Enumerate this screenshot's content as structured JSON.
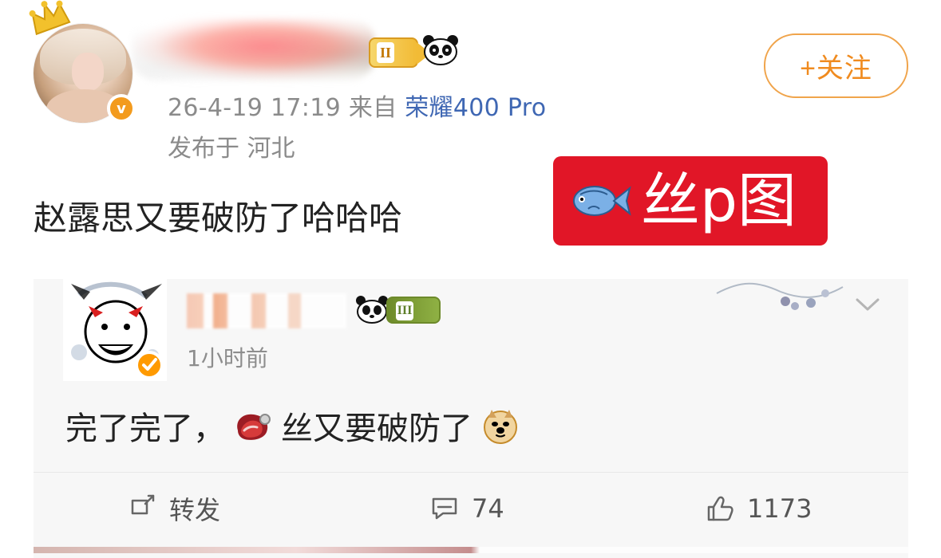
{
  "post": {
    "timestamp": "26-4-19 17:19",
    "source_prefix": "来自",
    "source_device": "荣耀400 Pro",
    "location_line": "发布于 河北",
    "text": "赵露思又要破防了哈哈哈",
    "follow_label": "+关注",
    "level_badge": "II",
    "sticker": {
      "text": "丝p图",
      "fish_icon": "fish-icon",
      "background_color": "#e11627"
    }
  },
  "repost": {
    "time": "1小时前",
    "text_parts": [
      "完了完了，",
      "丝又要破防了"
    ],
    "level_badge": "III",
    "steak_icon": "steak-icon",
    "doge_icon": "doge-icon",
    "chevron_icon": "chevron-down-icon"
  },
  "actions": {
    "repost_label": "转发",
    "comment_count": "74",
    "like_count": "1173",
    "icons": [
      "repost-icon",
      "comment-icon",
      "like-icon"
    ]
  },
  "colors": {
    "orange": "#f08b1f",
    "blue_link": "#3f67b3",
    "gray_text": "#8b8b8b",
    "card_bg": "#f7f7f7"
  }
}
